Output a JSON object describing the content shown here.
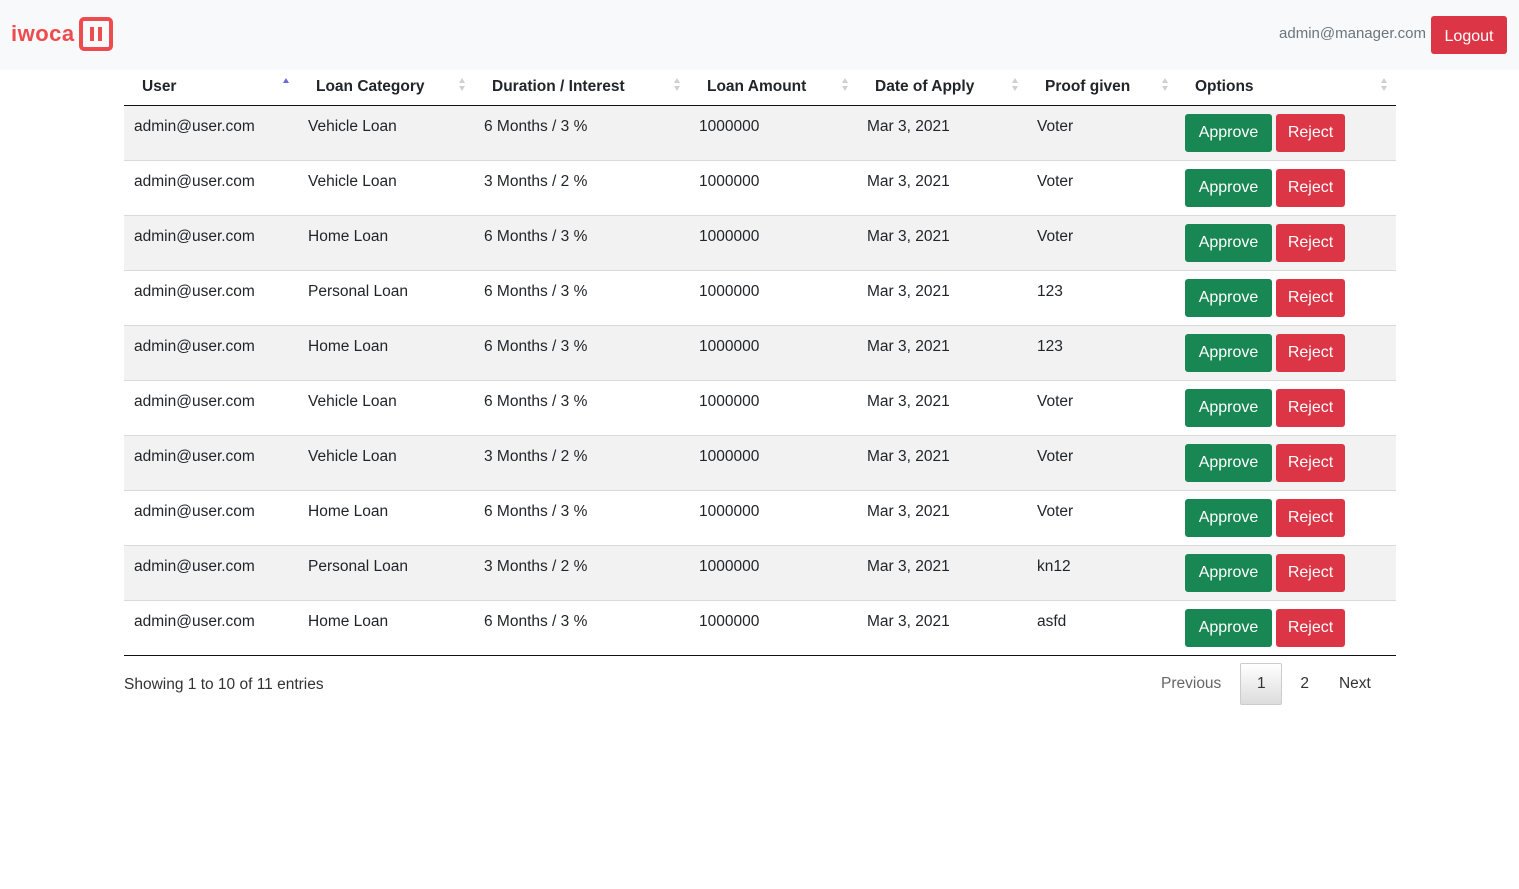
{
  "navbar": {
    "brand": "iwoca",
    "user_email": "admin@manager.com",
    "logout_label": "Logout",
    "brand_color": "#ee4b4f"
  },
  "table": {
    "columns": [
      {
        "label": "User",
        "sort": "ascending"
      },
      {
        "label": "Loan Category",
        "sort": "none"
      },
      {
        "label": "Duration / Interest",
        "sort": "none"
      },
      {
        "label": "Loan Amount",
        "sort": "none"
      },
      {
        "label": "Date of Apply",
        "sort": "none"
      },
      {
        "label": "Proof given",
        "sort": "none"
      },
      {
        "label": "Options",
        "sort": "none"
      }
    ],
    "approve_label": "Approve",
    "reject_label": "Reject",
    "rows": [
      {
        "user": "admin@user.com",
        "category": "Vehicle Loan",
        "duration": "6 Months / 3 %",
        "amount": "1000000",
        "date": "Mar 3, 2021",
        "proof": "Voter"
      },
      {
        "user": "admin@user.com",
        "category": "Vehicle Loan",
        "duration": "3 Months / 2 %",
        "amount": "1000000",
        "date": "Mar 3, 2021",
        "proof": "Voter"
      },
      {
        "user": "admin@user.com",
        "category": "Home Loan",
        "duration": "6 Months / 3 %",
        "amount": "1000000",
        "date": "Mar 3, 2021",
        "proof": "Voter"
      },
      {
        "user": "admin@user.com",
        "category": "Personal Loan",
        "duration": "6 Months / 3 %",
        "amount": "1000000",
        "date": "Mar 3, 2021",
        "proof": "123"
      },
      {
        "user": "admin@user.com",
        "category": "Home Loan",
        "duration": "6 Months / 3 %",
        "amount": "1000000",
        "date": "Mar 3, 2021",
        "proof": "123"
      },
      {
        "user": "admin@user.com",
        "category": "Vehicle Loan",
        "duration": "6 Months / 3 %",
        "amount": "1000000",
        "date": "Mar 3, 2021",
        "proof": "Voter"
      },
      {
        "user": "admin@user.com",
        "category": "Vehicle Loan",
        "duration": "3 Months / 2 %",
        "amount": "1000000",
        "date": "Mar 3, 2021",
        "proof": "Voter"
      },
      {
        "user": "admin@user.com",
        "category": "Home Loan",
        "duration": "6 Months / 3 %",
        "amount": "1000000",
        "date": "Mar 3, 2021",
        "proof": "Voter"
      },
      {
        "user": "admin@user.com",
        "category": "Personal Loan",
        "duration": "3 Months / 2 %",
        "amount": "1000000",
        "date": "Mar 3, 2021",
        "proof": "kn12"
      },
      {
        "user": "admin@user.com",
        "category": "Home Loan",
        "duration": "6 Months / 3 %",
        "amount": "1000000",
        "date": "Mar 3, 2021",
        "proof": "asfd"
      }
    ]
  },
  "footer": {
    "info": "Showing 1 to 10 of 11 entries",
    "pagination": {
      "previous": "Previous",
      "pages": [
        "1",
        "2"
      ],
      "current": "1",
      "next": "Next"
    }
  },
  "colors": {
    "approve": "#198754",
    "reject": "#dc3545",
    "sort_active": "#6b6bd6",
    "sort_inactive": "#d0d0d0"
  }
}
